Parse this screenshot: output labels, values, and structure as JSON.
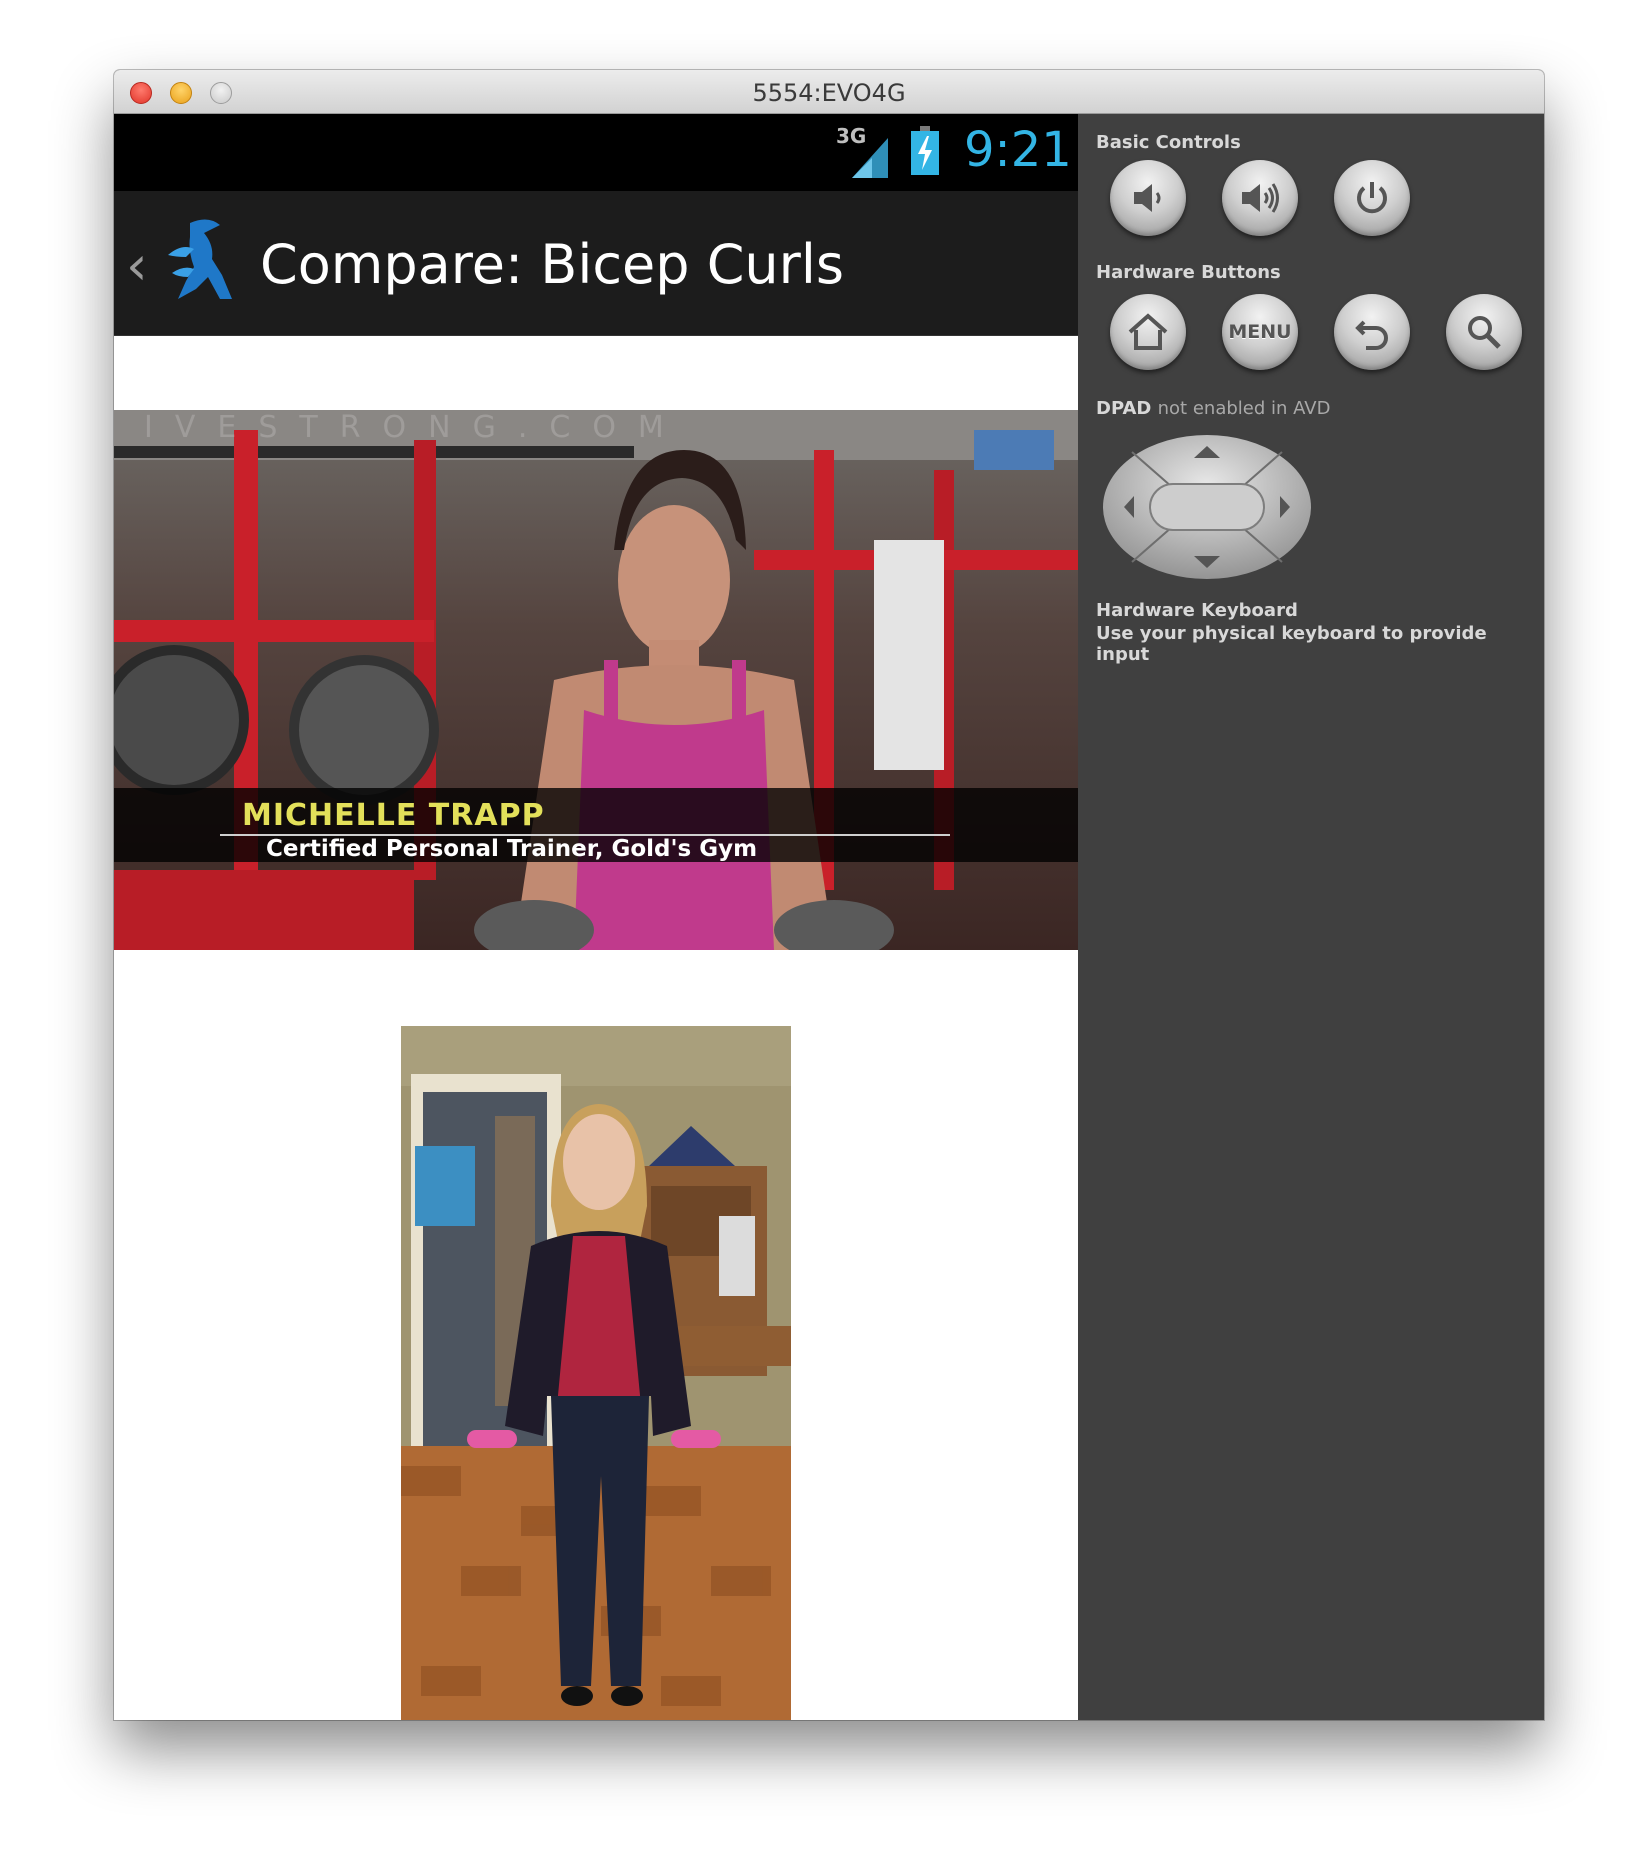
{
  "window": {
    "title": "5554:EVO4G"
  },
  "status_bar": {
    "network": "3G",
    "time": "9:21"
  },
  "action_bar": {
    "title": "Compare: Bicep Curls"
  },
  "video_top": {
    "watermark": "IVESTRONG.COM",
    "name": "MICHELLE  TRAPP",
    "subtitle": "Certified Personal Trainer, Gold's Gym"
  },
  "control_panel": {
    "basic_controls_label": "Basic Controls",
    "hardware_buttons_label": "Hardware Buttons",
    "menu_label": "MENU",
    "dpad_label": "DPAD",
    "dpad_note": "not enabled in AVD",
    "keyboard_label": "Hardware Keyboard",
    "keyboard_desc": "Use your physical keyboard to provide input"
  },
  "colors": {
    "clock": "#33b5e5",
    "name_text": "#e3e05a",
    "panel_bg": "#404040"
  },
  "icons": [
    "back-chevron-icon",
    "app-logo-icon",
    "signal-icon",
    "battery-charging-icon",
    "volume-down-icon",
    "volume-up-icon",
    "power-icon",
    "home-icon",
    "back-arrow-icon",
    "search-icon",
    "dpad-icon"
  ]
}
